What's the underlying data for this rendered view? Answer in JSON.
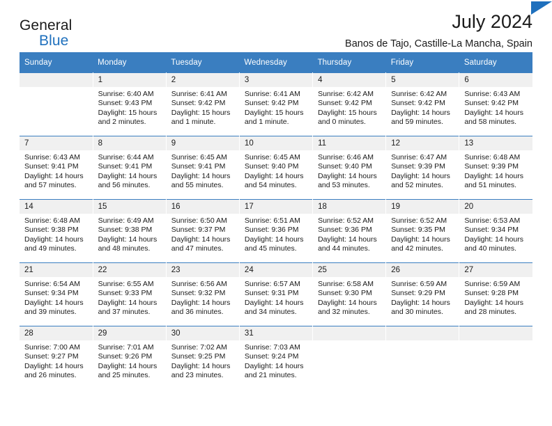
{
  "brand": {
    "name_part1": "General",
    "name_part2": "Blue",
    "flag_icon": "brand-flag-icon",
    "color_blue": "#1f70bd"
  },
  "header": {
    "title": "July 2024",
    "location": "Banos de Tajo, Castille-La Mancha, Spain"
  },
  "calendar": {
    "header_bg": "#3a7ec0",
    "daynum_bg": "#f0f0f0",
    "weekday_names": [
      "Sunday",
      "Monday",
      "Tuesday",
      "Wednesday",
      "Thursday",
      "Friday",
      "Saturday"
    ],
    "weeks": [
      [
        {
          "day": "",
          "sunrise": "",
          "sunset": "",
          "daylight1": "",
          "daylight2": "",
          "empty": true
        },
        {
          "day": "1",
          "sunrise": "Sunrise: 6:40 AM",
          "sunset": "Sunset: 9:43 PM",
          "daylight1": "Daylight: 15 hours",
          "daylight2": "and 2 minutes."
        },
        {
          "day": "2",
          "sunrise": "Sunrise: 6:41 AM",
          "sunset": "Sunset: 9:42 PM",
          "daylight1": "Daylight: 15 hours",
          "daylight2": "and 1 minute."
        },
        {
          "day": "3",
          "sunrise": "Sunrise: 6:41 AM",
          "sunset": "Sunset: 9:42 PM",
          "daylight1": "Daylight: 15 hours",
          "daylight2": "and 1 minute."
        },
        {
          "day": "4",
          "sunrise": "Sunrise: 6:42 AM",
          "sunset": "Sunset: 9:42 PM",
          "daylight1": "Daylight: 15 hours",
          "daylight2": "and 0 minutes."
        },
        {
          "day": "5",
          "sunrise": "Sunrise: 6:42 AM",
          "sunset": "Sunset: 9:42 PM",
          "daylight1": "Daylight: 14 hours",
          "daylight2": "and 59 minutes."
        },
        {
          "day": "6",
          "sunrise": "Sunrise: 6:43 AM",
          "sunset": "Sunset: 9:42 PM",
          "daylight1": "Daylight: 14 hours",
          "daylight2": "and 58 minutes."
        }
      ],
      [
        {
          "day": "7",
          "sunrise": "Sunrise: 6:43 AM",
          "sunset": "Sunset: 9:41 PM",
          "daylight1": "Daylight: 14 hours",
          "daylight2": "and 57 minutes."
        },
        {
          "day": "8",
          "sunrise": "Sunrise: 6:44 AM",
          "sunset": "Sunset: 9:41 PM",
          "daylight1": "Daylight: 14 hours",
          "daylight2": "and 56 minutes."
        },
        {
          "day": "9",
          "sunrise": "Sunrise: 6:45 AM",
          "sunset": "Sunset: 9:41 PM",
          "daylight1": "Daylight: 14 hours",
          "daylight2": "and 55 minutes."
        },
        {
          "day": "10",
          "sunrise": "Sunrise: 6:45 AM",
          "sunset": "Sunset: 9:40 PM",
          "daylight1": "Daylight: 14 hours",
          "daylight2": "and 54 minutes."
        },
        {
          "day": "11",
          "sunrise": "Sunrise: 6:46 AM",
          "sunset": "Sunset: 9:40 PM",
          "daylight1": "Daylight: 14 hours",
          "daylight2": "and 53 minutes."
        },
        {
          "day": "12",
          "sunrise": "Sunrise: 6:47 AM",
          "sunset": "Sunset: 9:39 PM",
          "daylight1": "Daylight: 14 hours",
          "daylight2": "and 52 minutes."
        },
        {
          "day": "13",
          "sunrise": "Sunrise: 6:48 AM",
          "sunset": "Sunset: 9:39 PM",
          "daylight1": "Daylight: 14 hours",
          "daylight2": "and 51 minutes."
        }
      ],
      [
        {
          "day": "14",
          "sunrise": "Sunrise: 6:48 AM",
          "sunset": "Sunset: 9:38 PM",
          "daylight1": "Daylight: 14 hours",
          "daylight2": "and 49 minutes."
        },
        {
          "day": "15",
          "sunrise": "Sunrise: 6:49 AM",
          "sunset": "Sunset: 9:38 PM",
          "daylight1": "Daylight: 14 hours",
          "daylight2": "and 48 minutes."
        },
        {
          "day": "16",
          "sunrise": "Sunrise: 6:50 AM",
          "sunset": "Sunset: 9:37 PM",
          "daylight1": "Daylight: 14 hours",
          "daylight2": "and 47 minutes."
        },
        {
          "day": "17",
          "sunrise": "Sunrise: 6:51 AM",
          "sunset": "Sunset: 9:36 PM",
          "daylight1": "Daylight: 14 hours",
          "daylight2": "and 45 minutes."
        },
        {
          "day": "18",
          "sunrise": "Sunrise: 6:52 AM",
          "sunset": "Sunset: 9:36 PM",
          "daylight1": "Daylight: 14 hours",
          "daylight2": "and 44 minutes."
        },
        {
          "day": "19",
          "sunrise": "Sunrise: 6:52 AM",
          "sunset": "Sunset: 9:35 PM",
          "daylight1": "Daylight: 14 hours",
          "daylight2": "and 42 minutes."
        },
        {
          "day": "20",
          "sunrise": "Sunrise: 6:53 AM",
          "sunset": "Sunset: 9:34 PM",
          "daylight1": "Daylight: 14 hours",
          "daylight2": "and 40 minutes."
        }
      ],
      [
        {
          "day": "21",
          "sunrise": "Sunrise: 6:54 AM",
          "sunset": "Sunset: 9:34 PM",
          "daylight1": "Daylight: 14 hours",
          "daylight2": "and 39 minutes."
        },
        {
          "day": "22",
          "sunrise": "Sunrise: 6:55 AM",
          "sunset": "Sunset: 9:33 PM",
          "daylight1": "Daylight: 14 hours",
          "daylight2": "and 37 minutes."
        },
        {
          "day": "23",
          "sunrise": "Sunrise: 6:56 AM",
          "sunset": "Sunset: 9:32 PM",
          "daylight1": "Daylight: 14 hours",
          "daylight2": "and 36 minutes."
        },
        {
          "day": "24",
          "sunrise": "Sunrise: 6:57 AM",
          "sunset": "Sunset: 9:31 PM",
          "daylight1": "Daylight: 14 hours",
          "daylight2": "and 34 minutes."
        },
        {
          "day": "25",
          "sunrise": "Sunrise: 6:58 AM",
          "sunset": "Sunset: 9:30 PM",
          "daylight1": "Daylight: 14 hours",
          "daylight2": "and 32 minutes."
        },
        {
          "day": "26",
          "sunrise": "Sunrise: 6:59 AM",
          "sunset": "Sunset: 9:29 PM",
          "daylight1": "Daylight: 14 hours",
          "daylight2": "and 30 minutes."
        },
        {
          "day": "27",
          "sunrise": "Sunrise: 6:59 AM",
          "sunset": "Sunset: 9:28 PM",
          "daylight1": "Daylight: 14 hours",
          "daylight2": "and 28 minutes."
        }
      ],
      [
        {
          "day": "28",
          "sunrise": "Sunrise: 7:00 AM",
          "sunset": "Sunset: 9:27 PM",
          "daylight1": "Daylight: 14 hours",
          "daylight2": "and 26 minutes."
        },
        {
          "day": "29",
          "sunrise": "Sunrise: 7:01 AM",
          "sunset": "Sunset: 9:26 PM",
          "daylight1": "Daylight: 14 hours",
          "daylight2": "and 25 minutes."
        },
        {
          "day": "30",
          "sunrise": "Sunrise: 7:02 AM",
          "sunset": "Sunset: 9:25 PM",
          "daylight1": "Daylight: 14 hours",
          "daylight2": "and 23 minutes."
        },
        {
          "day": "31",
          "sunrise": "Sunrise: 7:03 AM",
          "sunset": "Sunset: 9:24 PM",
          "daylight1": "Daylight: 14 hours",
          "daylight2": "and 21 minutes."
        },
        {
          "day": "",
          "sunrise": "",
          "sunset": "",
          "daylight1": "",
          "daylight2": "",
          "empty": true
        },
        {
          "day": "",
          "sunrise": "",
          "sunset": "",
          "daylight1": "",
          "daylight2": "",
          "empty": true
        },
        {
          "day": "",
          "sunrise": "",
          "sunset": "",
          "daylight1": "",
          "daylight2": "",
          "empty": true
        }
      ]
    ]
  }
}
